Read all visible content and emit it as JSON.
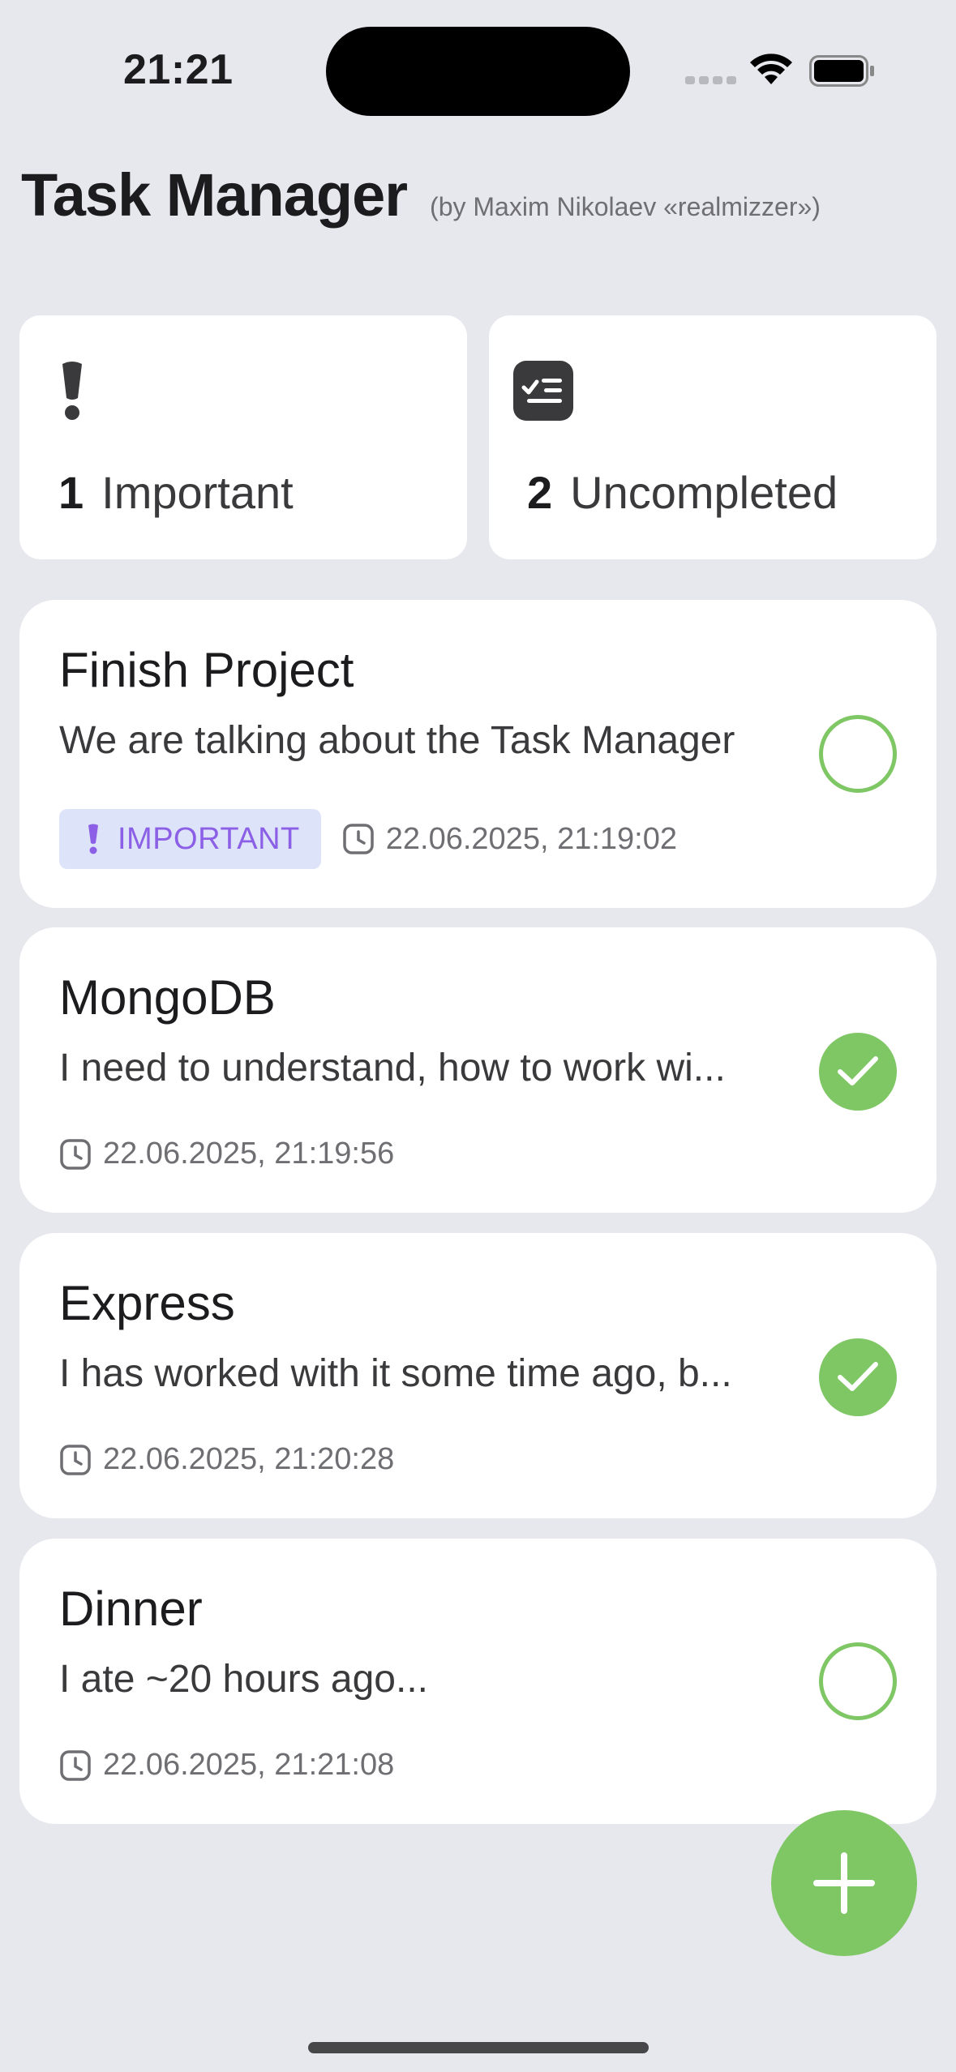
{
  "status_bar": {
    "time": "21:21"
  },
  "header": {
    "title": "Task Manager",
    "subtitle": "(by Maxim Nikolaev «realmizzer»)"
  },
  "summary": {
    "important": {
      "count": "1",
      "label": "Important",
      "icon": "exclamation-icon"
    },
    "uncompleted": {
      "count": "2",
      "label": "Uncompleted",
      "icon": "checklist-icon"
    }
  },
  "tasks": [
    {
      "title": "Finish Project",
      "description": "We are talking about the Task Manager",
      "important_label": "IMPORTANT",
      "date": "22.06.2025, 21:19:02",
      "completed": false
    },
    {
      "title": "MongoDB",
      "description": "I need to understand, how to work wi...",
      "date": "22.06.2025, 21:19:56",
      "completed": true
    },
    {
      "title": "Express",
      "description": "I has worked with it some time ago, b...",
      "date": "22.06.2025, 21:20:28",
      "completed": true
    },
    {
      "title": "Dinner",
      "description": "I ate ~20 hours ago...",
      "date": "22.06.2025, 21:21:08",
      "completed": false
    }
  ],
  "colors": {
    "background": "#e7e7ee",
    "accent_green": "#7ec764",
    "important_purple": "#8c60e6",
    "badge_bg": "#dde3f8"
  }
}
